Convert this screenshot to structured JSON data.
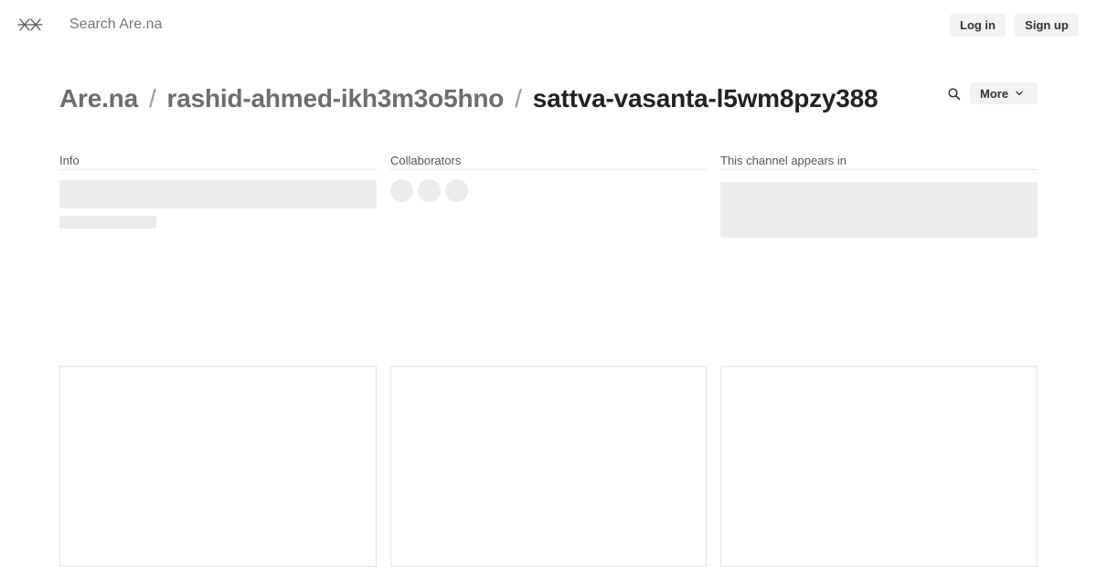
{
  "header": {
    "logo_icon": "arena-logo-icon",
    "search": {
      "placeholder": "Search Are.na",
      "value": ""
    },
    "login_label": "Log in",
    "signup_label": "Sign up"
  },
  "breadcrumb": {
    "root": "Are.na",
    "user": "rashid-ahmed-ikh3m3o5hno",
    "channel": "sattva-vasanta-l5wm8pzy388",
    "separator": "/"
  },
  "channel_actions": {
    "search_icon": "search-icon",
    "more_label": "More",
    "more_icon": "chevron-down-icon"
  },
  "sections": {
    "info": "Info",
    "collaborators": "Collaborators",
    "appears_in": "This channel appears in"
  },
  "colors": {
    "skeleton": "#ebebeb",
    "button_bg": "#f2f2f2",
    "crumb_muted": "#6d6d6d",
    "crumb_current": "#222222"
  }
}
